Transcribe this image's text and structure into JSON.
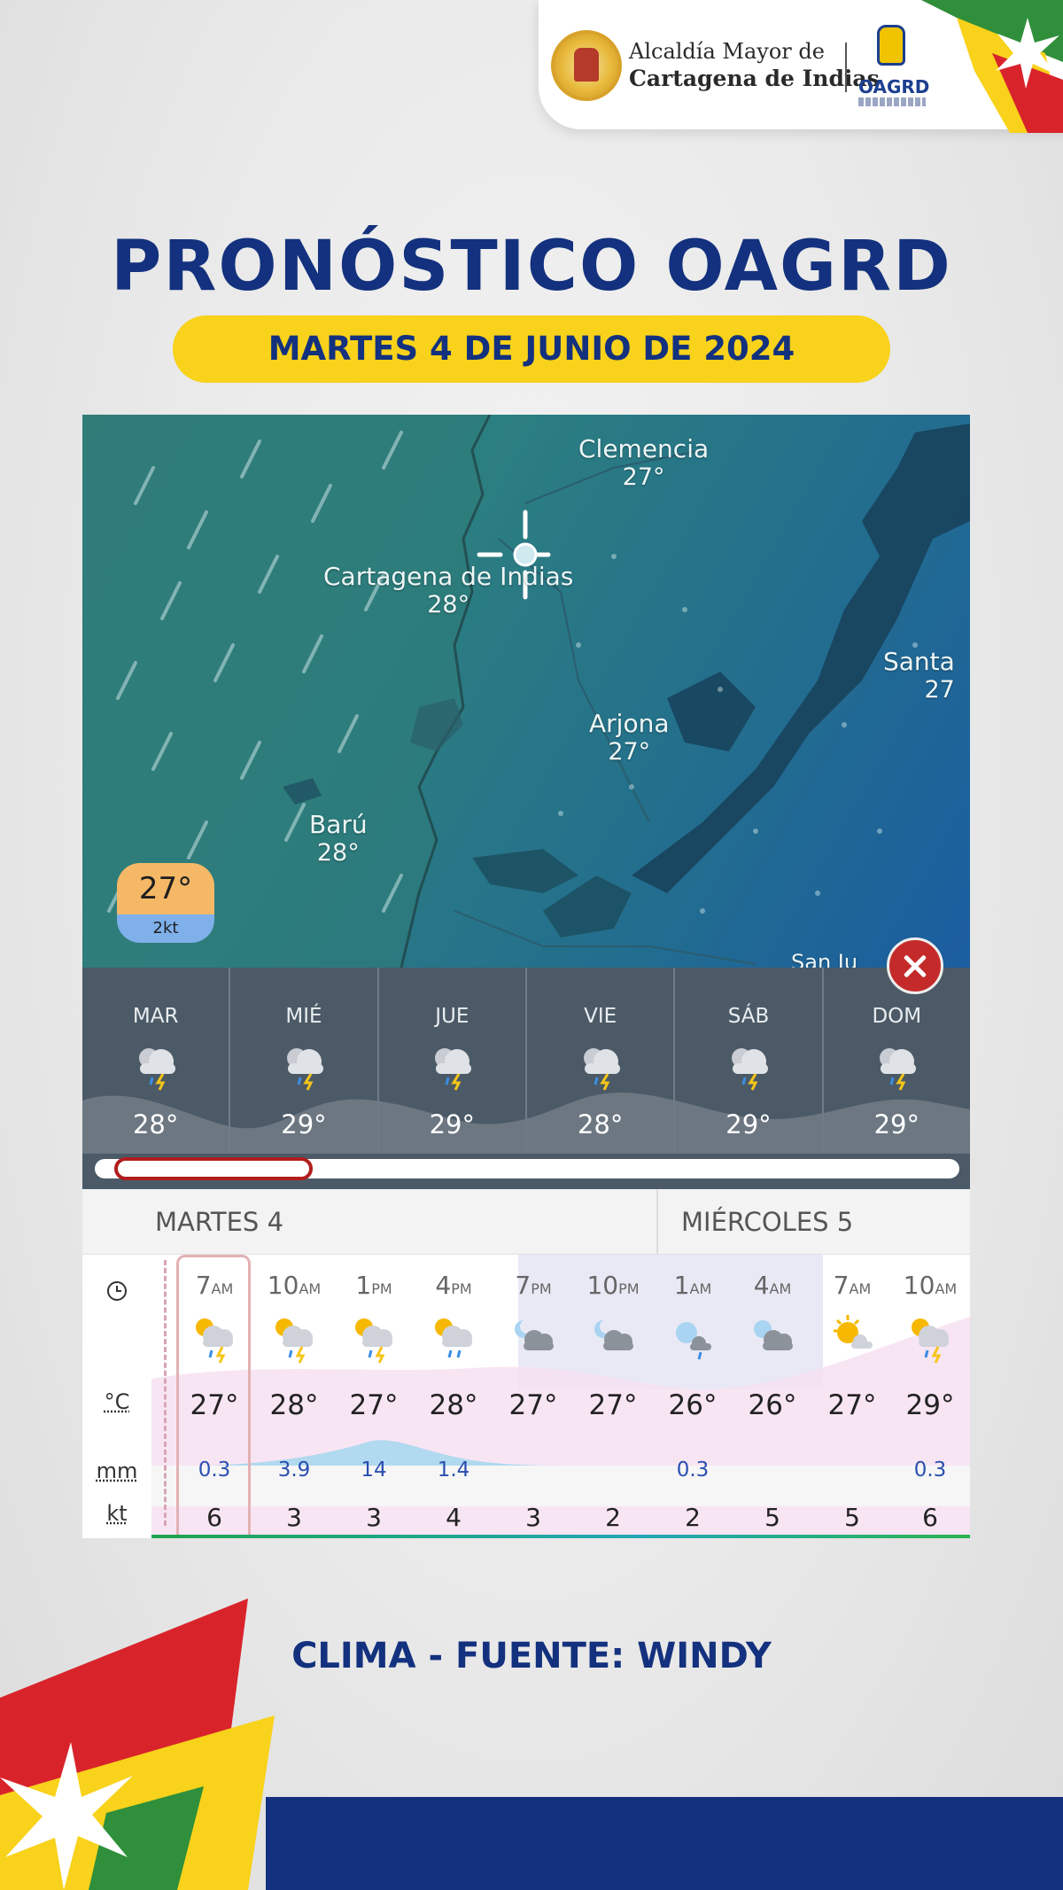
{
  "header": {
    "org_line1": "Alcaldía Mayor de",
    "org_line2": "Cartagena de Indias",
    "agency": "OAGRD"
  },
  "title": "PRONÓSTICO OAGRD",
  "date": "MARTES 4 DE JUNIO DE 2024",
  "map": {
    "cities": [
      {
        "name": "Clemencia",
        "temp": "27°"
      },
      {
        "name": "Cartagena de Indias",
        "temp": "28°"
      },
      {
        "name": "Santa",
        "temp": "27"
      },
      {
        "name": "Arjona",
        "temp": "27°"
      },
      {
        "name": "Barú",
        "temp": "28°"
      },
      {
        "name": "San Ju",
        "temp": ""
      }
    ],
    "current_temp": "27°",
    "current_wind": "2kt"
  },
  "days": [
    {
      "name": "MAR",
      "temp": "28°",
      "icon": "thunderstorm-icon"
    },
    {
      "name": "MIÉ",
      "temp": "29°",
      "icon": "thunderstorm-icon"
    },
    {
      "name": "JUE",
      "temp": "29°",
      "icon": "thunderstorm-icon"
    },
    {
      "name": "VIE",
      "temp": "28°",
      "icon": "thunderstorm-icon"
    },
    {
      "name": "SÁB",
      "temp": "29°",
      "icon": "thunderstorm-icon"
    },
    {
      "name": "DOM",
      "temp": "29°",
      "icon": "thunderstorm-icon"
    }
  ],
  "forecast": {
    "day1": "MARTES 4",
    "day2": "MIÉRCOLES 5",
    "row_labels": {
      "temp": "°C",
      "rain": "mm",
      "wind": "kt"
    },
    "hours": [
      {
        "h": "7",
        "ap": "AM",
        "temp": "27°",
        "mm": "0.3",
        "kt": "6",
        "icon": "sun-cloud-thunder-icon"
      },
      {
        "h": "10",
        "ap": "AM",
        "temp": "28°",
        "mm": "3.9",
        "kt": "3",
        "icon": "sun-cloud-thunder-icon"
      },
      {
        "h": "1",
        "ap": "PM",
        "temp": "27°",
        "mm": "14",
        "kt": "3",
        "icon": "sun-cloud-thunder-icon"
      },
      {
        "h": "4",
        "ap": "PM",
        "temp": "28°",
        "mm": "1.4",
        "kt": "4",
        "icon": "sun-cloud-rain-icon"
      },
      {
        "h": "7",
        "ap": "PM",
        "temp": "27°",
        "mm": "",
        "kt": "3",
        "icon": "moon-cloud-icon"
      },
      {
        "h": "10",
        "ap": "PM",
        "temp": "27°",
        "mm": "",
        "kt": "2",
        "icon": "moon-cloud-icon"
      },
      {
        "h": "1",
        "ap": "AM",
        "temp": "26°",
        "mm": "0.3",
        "kt": "2",
        "icon": "moon-cloud-rain-icon"
      },
      {
        "h": "4",
        "ap": "AM",
        "temp": "26°",
        "mm": "",
        "kt": "5",
        "icon": "moon-cloud-icon"
      },
      {
        "h": "7",
        "ap": "AM",
        "temp": "27°",
        "mm": "",
        "kt": "5",
        "icon": "sun-cloud-icon"
      },
      {
        "h": "10",
        "ap": "AM",
        "temp": "29°",
        "mm": "0.3",
        "kt": "6",
        "icon": "sun-cloud-thunder-icon"
      }
    ]
  },
  "source": "CLIMA - FUENTE: WINDY",
  "colors": {
    "navy": "#13317e",
    "yellow": "#f8d21b",
    "red": "#d9232b",
    "green": "#2f8f3a"
  }
}
